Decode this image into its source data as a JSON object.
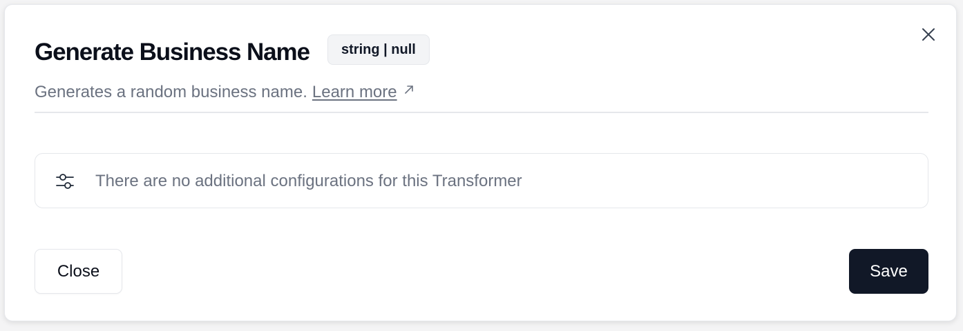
{
  "dialog": {
    "title": "Generate Business Name",
    "type_badge": "string | null",
    "description": "Generates a random business name.",
    "learn_more_label": "Learn more",
    "config_message": "There are no additional configurations for this Transformer"
  },
  "footer": {
    "close_label": "Close",
    "save_label": "Save"
  },
  "icons": {
    "close": "close-icon",
    "external_link": "arrow-up-right-icon",
    "config": "sliders-icon"
  },
  "colors": {
    "primary_button": "#111827",
    "muted_text": "#6b7280",
    "border": "#e5e7eb"
  }
}
